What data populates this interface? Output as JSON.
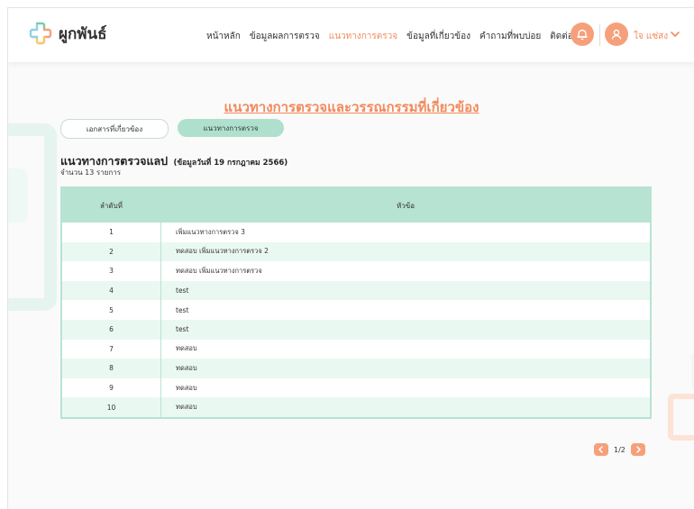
{
  "brand": {
    "name": "ผูกพันธ์"
  },
  "nav": {
    "items": [
      {
        "label": "หน้าหลัก"
      },
      {
        "label": "ข้อมูลผลการตรวจ"
      },
      {
        "label": "แนวทางการตรวจ"
      },
      {
        "label": "ข้อมูลที่เกี่ยวข้อง"
      },
      {
        "label": "คำถามที่พบบ่อย"
      },
      {
        "label": "ติดต่อเรา"
      }
    ],
    "active_index": 2
  },
  "user": {
    "name": "ใจ แซ่สง"
  },
  "colors": {
    "accent": "#f28a5c",
    "mint": "#b6e3d2",
    "mint_light": "#eaf8f2"
  },
  "page": {
    "title": "แนวทางการตรวจและวรรณกรรมที่เกี่ยวข้อง"
  },
  "tabs": [
    {
      "label": "เอกสารที่เกี่ยวข้อง",
      "selected": false
    },
    {
      "label": "แนวทางการตรวจ",
      "selected": true
    }
  ],
  "section": {
    "title": "แนวทางการตรวจแลป",
    "subtitle": "(ข้อมูลวันที่ 19 กรกฎาคม 2566)",
    "count": "จำนวน 13 รายการ"
  },
  "table": {
    "headers": [
      "ลำดับที่",
      "หัวข้อ"
    ],
    "rows": [
      {
        "no": "1",
        "topic": "เพิ่มแนวทางการตรวจ 3"
      },
      {
        "no": "2",
        "topic": "ทดสอบ เพิ่มแนวทางการตรวจ 2"
      },
      {
        "no": "3",
        "topic": "ทดสอบ เพิ่มแนวทางการตรวจ"
      },
      {
        "no": "4",
        "topic": "test"
      },
      {
        "no": "5",
        "topic": "test"
      },
      {
        "no": "6",
        "topic": "test"
      },
      {
        "no": "7",
        "topic": "ทดสอบ"
      },
      {
        "no": "8",
        "topic": "ทดสอบ"
      },
      {
        "no": "9",
        "topic": "ทดสอบ"
      },
      {
        "no": "10",
        "topic": "ทดสอบ"
      }
    ]
  },
  "pagination": {
    "text": "1/2"
  },
  "icons": {
    "logo": "plus-cross-logo-icon",
    "bell": "bell-icon",
    "user": "user-icon",
    "chevron": "chevron-down-icon",
    "prev": "chevron-left-icon",
    "next": "chevron-right-icon"
  }
}
